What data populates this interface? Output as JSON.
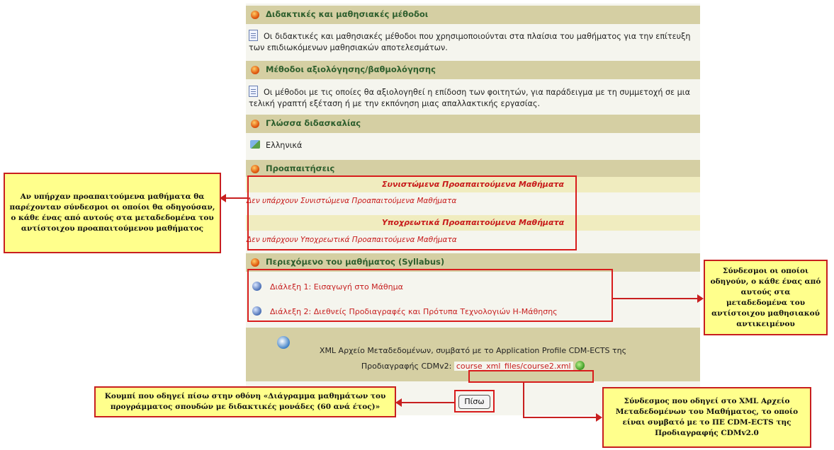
{
  "sections": {
    "methods": {
      "title": "Διδακτικές και μαθησιακές μέθοδοι",
      "text": "Οι διδακτικές και μαθησιακές μέθοδοι που χρησιμοποιούνται στα πλαίσια του μαθήματος για την επίτευξη των επιδιωκόμενων μαθησιακών αποτελεσμάτων."
    },
    "assessment": {
      "title": "Μέθοδοι αξιολόγησης/βαθμολόγησης",
      "text": "Οι μέθοδοι με τις οποίες θα αξιολογηθεί η επίδοση των φοιτητών, για παράδειγμα με τη συμμετοχή σε μια τελική γραπτή εξέταση ή με την εκπόνηση μιας απαλλακτικής εργασίας."
    },
    "language": {
      "title": "Γλώσσα διδασκαλίας",
      "value": "Ελληνικά"
    },
    "prerequisites": {
      "title": "Προαπαιτήσεις",
      "recommended_header": "Συνιστώμενα Προαπαιτούμενα Μαθήματα",
      "recommended_none": "Δεν υπάρχουν Συνιστώμενα Προαπαιτούμενα Μαθήματα",
      "required_header": "Υποχρεωτικά Προαπαιτούμενα Μαθήματα",
      "required_none": "Δεν υπάρχουν Υποχρεωτικά Προαπαιτούμενα Μαθήματα"
    },
    "syllabus": {
      "title": "Περιεχόμενο του μαθήματος (Syllabus)",
      "lectures": [
        "Διάλεξη 1: Εισαγωγή στο Μάθημα",
        "Διάλεξη 2: Διεθνείς Προδιαγραφές και Πρότυπα Τεχνολογιών Η-Μάθησης"
      ]
    },
    "xml": {
      "text_line1": "XML Αρχείο Μεταδεδομένων, συμβατό με το Application Profile CDM-ECTS της",
      "text_line2": "Προδιαγραφής CDMv2:",
      "link": "course_xml_files/course2.xml"
    }
  },
  "back_button": "Πίσω",
  "annotations": {
    "prereq_note": "Αν υπήρχαν προαπαιτούμενα μαθήματα θα παρέχονταν σύνδεσμοι οι οποίοι θα οδηγούσαν, ο κάθε ένας από αυτούς στα μεταδεδομένα του αντίστοιχου προαπαιτούμενου μαθήματος",
    "syllabus_note": "Σύνδεσμοι οι οποίοι οδηγούν, ο κάθε ένας από αυτούς στα μεταδεδομένα του αντίστοιχου μαθησιακού αντικειμένου",
    "back_note": "Κουμπί που οδηγεί πίσω στην οθόνη «Διάγραμμα μαθημάτων του προγράμματος σπουδών με διδακτικές μονάδες (60 ανά έτος)»",
    "xml_note": "Σύνδεσμος που οδηγεί στο XML Αρχείο Μεταδεδομένων του Μαθήματος, το οποίο είναι συμβατό με το ΠΕ CDM-ECTS της Προδιαγραφής CDMv2.0"
  },
  "colors": {
    "section_header_bg": "#d5cfa3",
    "section_title": "#2e5f2e",
    "link_red": "#c71a1a",
    "note_bg": "#ffff8c",
    "annotation_red": "#c81f1f"
  }
}
